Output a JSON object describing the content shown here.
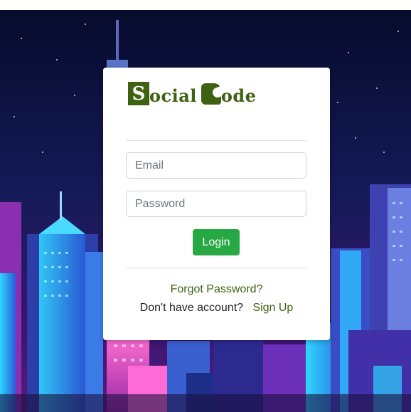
{
  "brand": {
    "first_letter": "S",
    "first_word_rest": "ocial",
    "second_word_rest": "ode",
    "color": "#3f6212"
  },
  "form": {
    "email_placeholder": "Email",
    "password_placeholder": "Password",
    "login_label": "Login"
  },
  "footer_links": {
    "forgot_password": "Forgot Password?",
    "no_account_text": "Don't have account?",
    "sign_up": "Sign Up"
  },
  "colors": {
    "login_button": "#28a745",
    "sky_top": "#070b2c",
    "sky_bottom": "#3a1670",
    "neon_cyan": "#2fd6ff",
    "neon_pink": "#ff3fb3"
  }
}
